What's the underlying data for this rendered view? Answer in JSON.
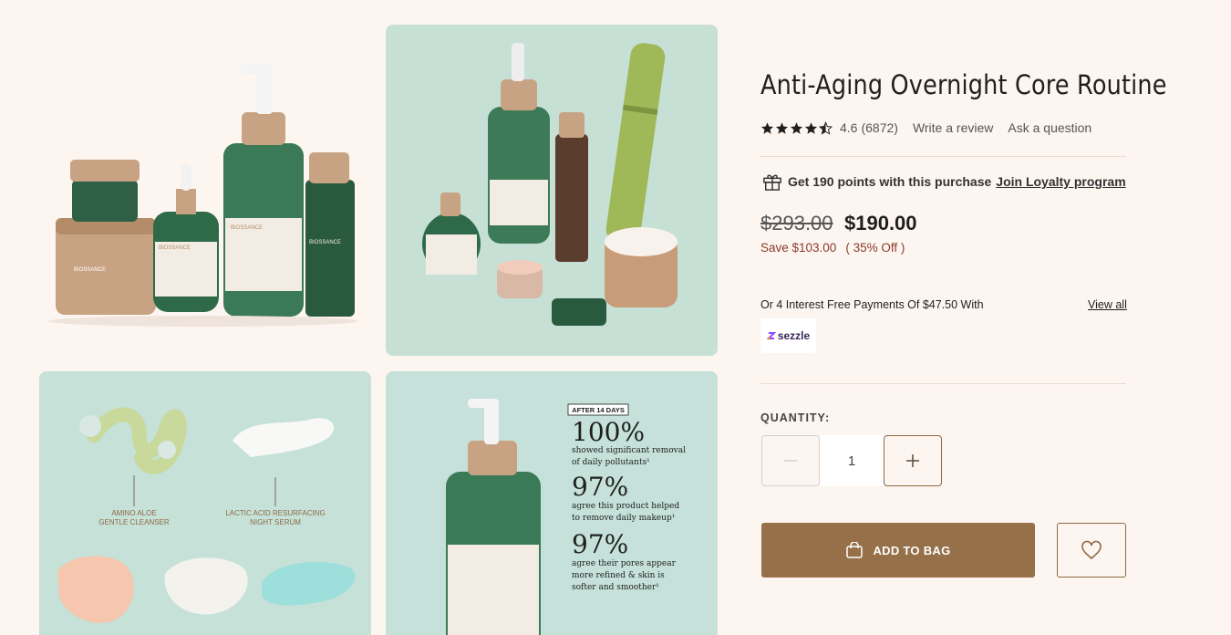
{
  "product": {
    "title": "Anti-Aging Overnight Core Routine",
    "rating": "4.6",
    "review_count": "(6872)",
    "write_review": "Write a review",
    "ask_question": "Ask a question",
    "stars": 4.6
  },
  "loyalty": {
    "text": "Get 190 points with this purchase",
    "link": "Join Loyalty program"
  },
  "price": {
    "original": "$293.00",
    "current": "$190.00",
    "save": "Save $103.00",
    "discount": "( 35% Off )"
  },
  "installments": {
    "text": "Or 4 Interest Free Payments Of $47.50 With",
    "view_all": "View all",
    "provider": "sezzle"
  },
  "quantity": {
    "label": "QUANTITY:",
    "value": "1"
  },
  "actions": {
    "add_to_bag": "ADD TO BAG"
  },
  "gallery": {
    "tile1": {
      "labels": [
        "BIOSSANCE",
        "BIOSSANCE",
        "BIOSSANCE",
        "BIOSSANCE",
        "BIOSSANCE"
      ]
    },
    "tile3": {
      "label_a": "AMINO ALOE",
      "label_a2": "GENTLE CLEANSER",
      "label_b": "LACTIC ACID RESURFACING",
      "label_b2": "NIGHT SERUM"
    },
    "tile4": {
      "badge": "AFTER 14 DAYS",
      "stat1": "100%",
      "stat1_text1": "showed significant removal",
      "stat1_text2": "of daily pollutants¹",
      "stat2": "97%",
      "stat2_text1": "agree this product helped",
      "stat2_text2": "to remove daily makeup¹",
      "stat3": "97%",
      "stat3_text1": "agree their pores appear",
      "stat3_text2": "more refined & skin is",
      "stat3_text3": "softer and smoother¹"
    }
  },
  "colors": {
    "background": "#fdf5f0",
    "accent": "#957049",
    "sale": "#8b3a2a"
  }
}
